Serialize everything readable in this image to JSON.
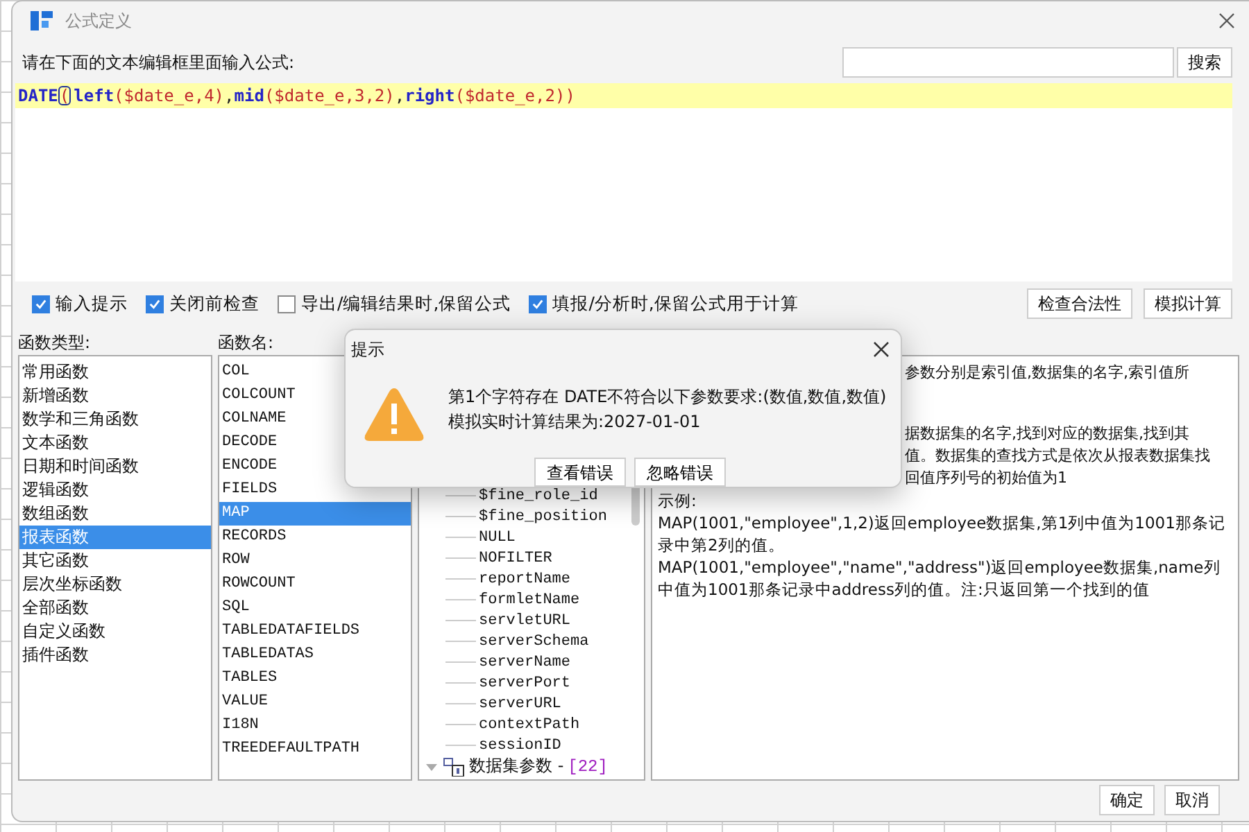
{
  "window": {
    "title": "公式定义"
  },
  "prompt": "请在下面的文本编辑框里面输入公式:",
  "search": {
    "button": "搜索"
  },
  "formula": [
    {
      "kind": "function",
      "text": "DATE",
      "matched": false
    },
    {
      "kind": "paren",
      "text": "(",
      "matched": true
    },
    {
      "kind": "function",
      "text": "left",
      "matched": false
    },
    {
      "kind": "args",
      "text": "($date_e,4)",
      "matched": false
    },
    {
      "kind": "punct",
      "text": ",",
      "matched": false
    },
    {
      "kind": "function",
      "text": "mid",
      "matched": false
    },
    {
      "kind": "args",
      "text": "($date_e,3,2)",
      "matched": false
    },
    {
      "kind": "punct",
      "text": ",",
      "matched": false
    },
    {
      "kind": "function",
      "text": "right",
      "matched": false
    },
    {
      "kind": "args",
      "text": "($date_e,2)",
      "matched": false
    },
    {
      "kind": "paren",
      "text": ")",
      "matched": false
    }
  ],
  "options": [
    {
      "label": "输入提示",
      "checked": true
    },
    {
      "label": "关闭前检查",
      "checked": true
    },
    {
      "label": "导出/编辑结果时,保留公式",
      "checked": false
    },
    {
      "label": "填报/分析时,保留公式用于计算",
      "checked": true
    }
  ],
  "actions": [
    "检查合法性",
    "模拟计算"
  ],
  "function_types": {
    "label": "函数类型:",
    "items": [
      {
        "label": "常用函数",
        "selected": false
      },
      {
        "label": "新增函数",
        "selected": false
      },
      {
        "label": "数学和三角函数",
        "selected": false
      },
      {
        "label": "文本函数",
        "selected": false
      },
      {
        "label": "日期和时间函数",
        "selected": false
      },
      {
        "label": "逻辑函数",
        "selected": false
      },
      {
        "label": "数组函数",
        "selected": false
      },
      {
        "label": "报表函数",
        "selected": true
      },
      {
        "label": "其它函数",
        "selected": false
      },
      {
        "label": "层次坐标函数",
        "selected": false
      },
      {
        "label": "全部函数",
        "selected": false
      },
      {
        "label": "自定义函数",
        "selected": false
      },
      {
        "label": "插件函数",
        "selected": false
      }
    ]
  },
  "function_names": {
    "label": "函数名:",
    "items": [
      {
        "label": "COL",
        "selected": false
      },
      {
        "label": "COLCOUNT",
        "selected": false
      },
      {
        "label": "COLNAME",
        "selected": false
      },
      {
        "label": "DECODE",
        "selected": false
      },
      {
        "label": "ENCODE",
        "selected": false
      },
      {
        "label": "FIELDS",
        "selected": false
      },
      {
        "label": "MAP",
        "selected": true
      },
      {
        "label": "RECORDS",
        "selected": false
      },
      {
        "label": "ROW",
        "selected": false
      },
      {
        "label": "ROWCOUNT",
        "selected": false
      },
      {
        "label": "SQL",
        "selected": false
      },
      {
        "label": "TABLEDATAFIELDS",
        "selected": false
      },
      {
        "label": "TABLEDATAS",
        "selected": false
      },
      {
        "label": "TABLES",
        "selected": false
      },
      {
        "label": "VALUE",
        "selected": false
      },
      {
        "label": "I18N",
        "selected": false
      },
      {
        "label": "TREEDEFAULTPATH",
        "selected": false
      }
    ]
  },
  "parameters": {
    "items": [
      "$fine_role_id",
      "$fine_position",
      "NULL",
      "NOFILTER",
      "reportName",
      "formletName",
      "servletURL",
      "serverSchema",
      "serverName",
      "serverPort",
      "serverURL",
      "contextPath",
      "sessionID"
    ],
    "group": {
      "label": "数据集参数 -",
      "count": "[22]"
    }
  },
  "description": {
    "covered_lines": [
      "参数分别是索引值,数据集的名字,索引值所",
      "据数据集的名字,找到对应的数据集,找到其",
      "值。数据集的查找方式是依次从报表数据集找",
      "回值序列号的初始值为1"
    ],
    "example_heading": "示例:",
    "examples": [
      "MAP(1001,\"employee\",1,2)返回employee数据集,第1列中值为1001那条记录中第2列的值。",
      "MAP(1001,\"employee\",\"name\",\"address\")返回employee数据集,name列中值为1001那条记录中address列的值。注:只返回第一个找到的值"
    ]
  },
  "footer": [
    "确定",
    "取消"
  ],
  "alert": {
    "title": "提示",
    "messages": [
      "第1个字符存在 DATE不符合以下参数要求:(数值,数值,数值)",
      "模拟实时计算结果为:2027-01-01"
    ],
    "buttons": [
      "查看错误",
      "忽略错误"
    ]
  }
}
